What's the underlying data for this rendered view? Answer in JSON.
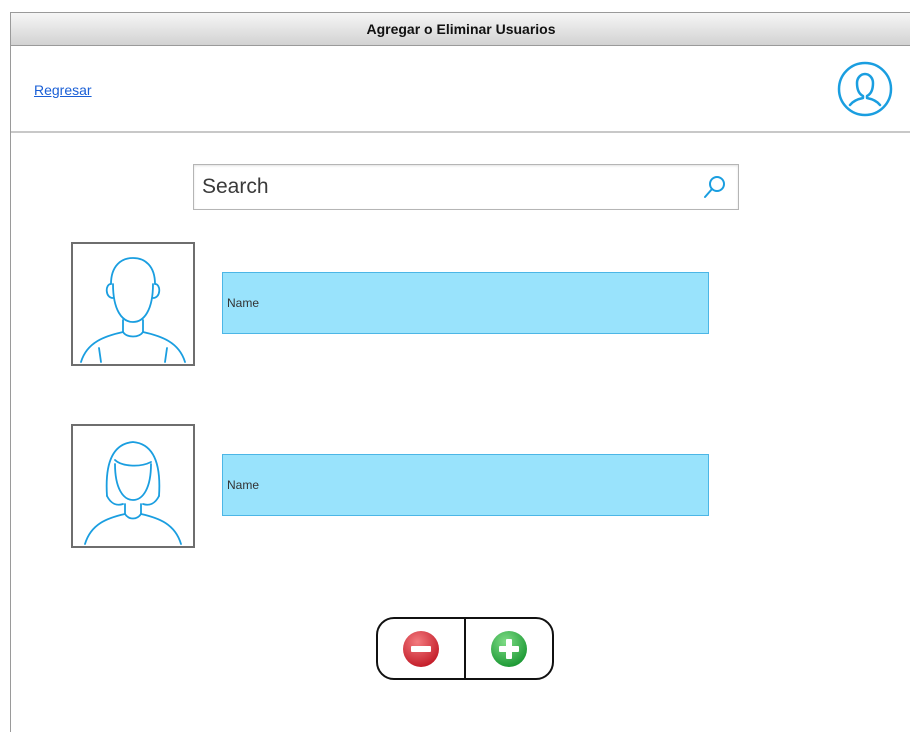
{
  "window": {
    "title": "Agregar o Eliminar Usuarios"
  },
  "header": {
    "back_label": "Regresar",
    "profile_icon": "user-circle-icon"
  },
  "search": {
    "placeholder": "Search",
    "icon": "search-icon"
  },
  "users": [
    {
      "name_label": "Name",
      "avatar": "male-avatar"
    },
    {
      "name_label": "Name",
      "avatar": "female-avatar"
    }
  ],
  "actions": {
    "remove_icon": "minus-circle-icon",
    "add_icon": "plus-circle-icon"
  },
  "colors": {
    "accent": "#1a9ee0",
    "name_field_bg": "#99e3fc",
    "remove_red": "#d9303a",
    "add_green": "#2fb34a",
    "link_blue": "#1a5fd6"
  }
}
